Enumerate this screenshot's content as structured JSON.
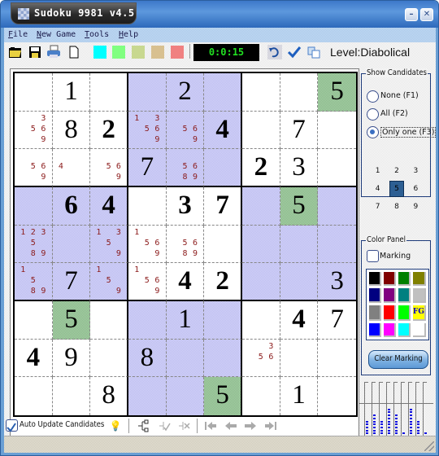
{
  "window": {
    "title": "Sudoku 9981 v4.5",
    "minimize_label": "–",
    "close_label": "✕"
  },
  "menu": [
    "File",
    "New Game",
    "Tools",
    "Help"
  ],
  "toolbar": {
    "icons": [
      "open-folder-icon",
      "save-disk-icon",
      "print-icon",
      "new-page-icon"
    ],
    "highlight_swatches": [
      "#00ffff",
      "#80ff80",
      "#c8d890",
      "#d8c090",
      "#f08080"
    ],
    "timer": "0:0:15",
    "right_icons": [
      "undo-icon",
      "check-icon",
      "copy-icon"
    ],
    "level": "Level:Diabolical"
  },
  "board": {
    "shaded_boxes": [
      1,
      3,
      5,
      7
    ],
    "rows": [
      [
        {
          "v": ""
        },
        {
          "v": "1"
        },
        {
          "v": ""
        },
        {
          "v": ""
        },
        {
          "v": "2"
        },
        {
          "v": ""
        },
        {
          "v": ""
        },
        {
          "v": ""
        },
        {
          "v": "5",
          "hl": "green"
        }
      ],
      [
        {
          "c": [
            "3",
            "5",
            "6",
            "9"
          ]
        },
        {
          "v": "8"
        },
        {
          "v": "2",
          "g": true
        },
        {
          "c": [
            "1",
            "3",
            "5",
            "6",
            "9"
          ]
        },
        {
          "c": [
            "5",
            "6",
            "9"
          ]
        },
        {
          "v": "4",
          "g": true
        },
        {
          "v": ""
        },
        {
          "v": "7"
        },
        {
          "v": ""
        }
      ],
      [
        {
          "c": [
            "5",
            "6",
            "9"
          ]
        },
        {
          "c": [
            "4"
          ]
        },
        {
          "c": [
            "5",
            "6",
            "9"
          ]
        },
        {
          "v": "7"
        },
        {
          "c": [
            "5",
            "6",
            "8",
            "9"
          ]
        },
        {
          "v": ""
        },
        {
          "v": "2",
          "g": true
        },
        {
          "v": "3"
        },
        {
          "v": ""
        }
      ],
      [
        {
          "v": ""
        },
        {
          "v": "6",
          "g": true
        },
        {
          "v": "4",
          "g": true
        },
        {
          "v": ""
        },
        {
          "v": "3",
          "g": true
        },
        {
          "v": "7",
          "g": true
        },
        {
          "v": ""
        },
        {
          "v": "5",
          "hl": "green"
        },
        {
          "v": ""
        }
      ],
      [
        {
          "c": [
            "1",
            "2",
            "3",
            "5",
            "8",
            "9"
          ]
        },
        {
          "v": ""
        },
        {
          "c": [
            "1",
            "3",
            "5",
            "9"
          ]
        },
        {
          "c": [
            "1",
            "5",
            "6",
            "9"
          ]
        },
        {
          "c": [
            "5",
            "6",
            "8",
            "9"
          ]
        },
        {
          "v": ""
        },
        {
          "v": ""
        },
        {
          "v": ""
        },
        {
          "v": ""
        }
      ],
      [
        {
          "c": [
            "1",
            "5",
            "8",
            "9"
          ]
        },
        {
          "v": "7"
        },
        {
          "c": [
            "1",
            "5",
            "9"
          ]
        },
        {
          "c": [
            "1",
            "5",
            "6",
            "9"
          ]
        },
        {
          "v": "4",
          "g": true
        },
        {
          "v": "2",
          "g": true
        },
        {
          "v": ""
        },
        {
          "v": ""
        },
        {
          "v": "3"
        }
      ],
      [
        {
          "v": ""
        },
        {
          "v": "5",
          "hl": "green"
        },
        {
          "v": ""
        },
        {
          "v": ""
        },
        {
          "v": "1"
        },
        {
          "v": ""
        },
        {
          "v": ""
        },
        {
          "v": "4",
          "g": true
        },
        {
          "v": "7"
        }
      ],
      [
        {
          "v": "4",
          "g": true
        },
        {
          "v": "9"
        },
        {
          "v": ""
        },
        {
          "v": "8"
        },
        {
          "v": ""
        },
        {
          "v": ""
        },
        {
          "c": [
            "3",
            "5",
            "6"
          ]
        },
        {
          "v": ""
        },
        {
          "v": ""
        }
      ],
      [
        {
          "v": ""
        },
        {
          "v": ""
        },
        {
          "v": "8"
        },
        {
          "v": ""
        },
        {
          "v": ""
        },
        {
          "v": "5",
          "hl": "green"
        },
        {
          "v": ""
        },
        {
          "v": "1"
        },
        {
          "v": ""
        }
      ]
    ]
  },
  "show_candidates": {
    "title": "Show Candidates",
    "options": [
      "None (F1)",
      "All (F2)",
      "Only one (F3)"
    ],
    "selected_option": 2,
    "digits": [
      "1",
      "2",
      "3",
      "4",
      "5",
      "6",
      "7",
      "8",
      "9"
    ],
    "selected_digit": "5"
  },
  "color_panel": {
    "title": "Color Panel",
    "marking_label": "Marking",
    "marking_checked": false,
    "colors": [
      "#000000",
      "#800000",
      "#008000",
      "#808000",
      "#000080",
      "#800080",
      "#008080",
      "#c0c0c0",
      "#808080",
      "#ff0000",
      "#00ff00",
      "#ffff00",
      "#0000ff",
      "#ff00ff",
      "#00ffff",
      "#ffffff"
    ],
    "fg_label": "FG",
    "clear_label": "Clear Marking"
  },
  "digit_counts": {
    "digits": [
      "1",
      "2",
      "3",
      "4",
      "5",
      "6",
      "7",
      "8",
      "9"
    ],
    "placed": [
      3,
      4,
      3,
      5,
      4,
      1,
      5,
      3,
      1
    ],
    "max": 9
  },
  "bottombar": {
    "auto_update_label": "Auto Update Candidates",
    "auto_update_checked": true,
    "icons": [
      "hint-bulb-icon",
      "tree-icon",
      "tree-check-icon",
      "tree-cross-icon",
      "first-icon",
      "prev-icon",
      "next-icon",
      "last-icon"
    ]
  }
}
